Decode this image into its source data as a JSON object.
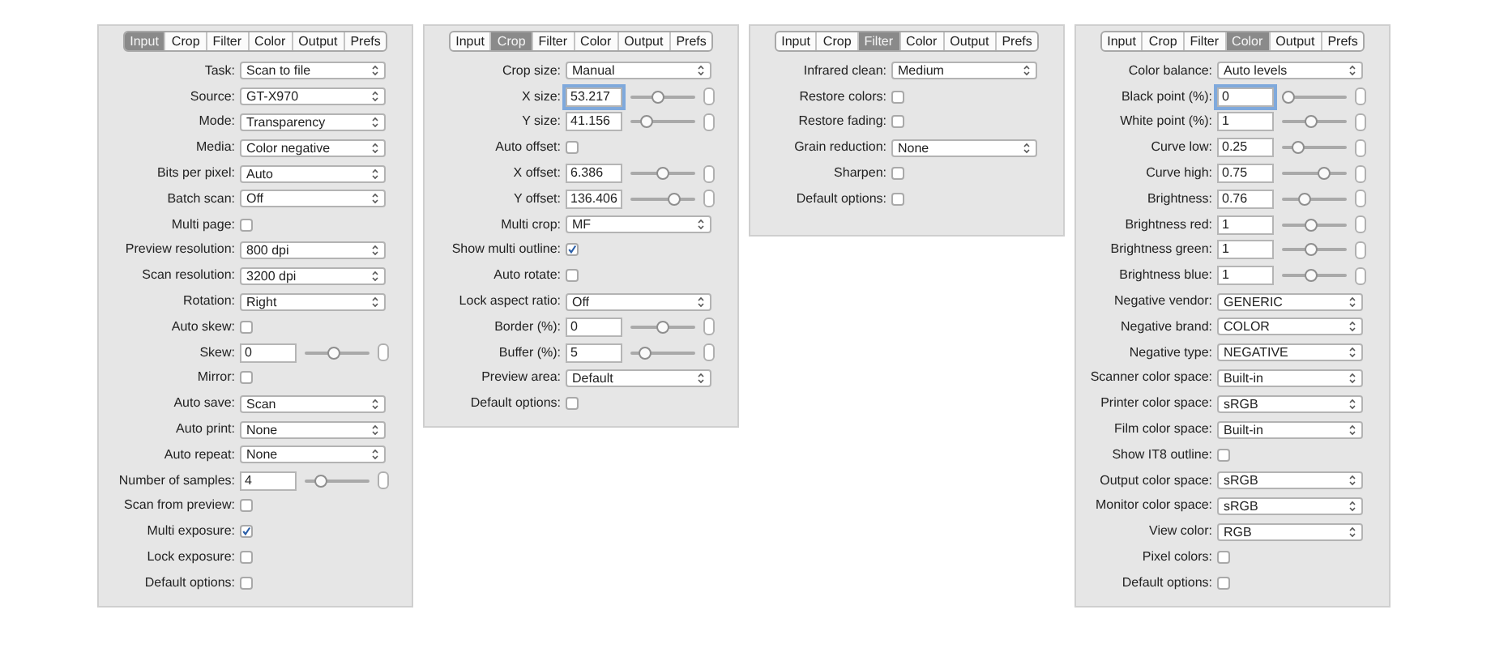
{
  "panels": [
    {
      "tabs": [
        {
          "label": "Input",
          "selected": true
        },
        {
          "label": "Crop",
          "selected": false
        },
        {
          "label": "Filter",
          "selected": false
        },
        {
          "label": "Color",
          "selected": false
        },
        {
          "label": "Output",
          "selected": false
        },
        {
          "label": "Prefs",
          "selected": false
        }
      ],
      "rows": [
        {
          "kind": "select",
          "label": "Task:",
          "value": "Scan to file"
        },
        {
          "kind": "select",
          "label": "Source:",
          "value": "GT-X970"
        },
        {
          "kind": "select",
          "label": "Mode:",
          "value": "Transparency"
        },
        {
          "kind": "select",
          "label": "Media:",
          "value": "Color negative"
        },
        {
          "kind": "select",
          "label": "Bits per pixel:",
          "value": "Auto"
        },
        {
          "kind": "select",
          "label": "Batch scan:",
          "value": "Off"
        },
        {
          "kind": "checkbox",
          "label": "Multi page:",
          "checked": false
        },
        {
          "kind": "select",
          "label": "Preview resolution:",
          "value": "800 dpi"
        },
        {
          "kind": "select",
          "label": "Scan resolution:",
          "value": "3200 dpi"
        },
        {
          "kind": "select",
          "label": "Rotation:",
          "value": "Right"
        },
        {
          "kind": "checkbox",
          "label": "Auto skew:",
          "checked": false
        },
        {
          "kind": "number",
          "label": "Skew:",
          "value": "0",
          "level": 0.45,
          "focused": false
        },
        {
          "kind": "checkbox",
          "label": "Mirror:",
          "checked": false
        },
        {
          "kind": "select",
          "label": "Auto save:",
          "value": "Scan"
        },
        {
          "kind": "select",
          "label": "Auto print:",
          "value": "None"
        },
        {
          "kind": "select",
          "label": "Auto repeat:",
          "value": "None"
        },
        {
          "kind": "number",
          "label": "Number of samples:",
          "value": "4",
          "level": 0.2,
          "focused": false
        },
        {
          "kind": "checkbox",
          "label": "Scan from preview:",
          "checked": false
        },
        {
          "kind": "checkbox",
          "label": "Multi exposure:",
          "checked": true
        },
        {
          "kind": "checkbox",
          "label": "Lock exposure:",
          "checked": false
        },
        {
          "kind": "checkbox",
          "label": "Default options:",
          "checked": false
        }
      ]
    },
    {
      "tabs": [
        {
          "label": "Input",
          "selected": false
        },
        {
          "label": "Crop",
          "selected": true
        },
        {
          "label": "Filter",
          "selected": false
        },
        {
          "label": "Color",
          "selected": false
        },
        {
          "label": "Output",
          "selected": false
        },
        {
          "label": "Prefs",
          "selected": false
        }
      ],
      "rows": [
        {
          "kind": "select",
          "label": "Crop size:",
          "value": "Manual"
        },
        {
          "kind": "number",
          "label": "X size:",
          "value": "53.217",
          "level": 0.4,
          "focused": true
        },
        {
          "kind": "number",
          "label": "Y size:",
          "value": "41.156",
          "level": 0.18,
          "focused": false
        },
        {
          "kind": "checkbox",
          "label": "Auto offset:",
          "checked": false
        },
        {
          "kind": "number",
          "label": "X offset:",
          "value": "6.386",
          "level": 0.5,
          "focused": false
        },
        {
          "kind": "number",
          "label": "Y offset:",
          "value": "136.406",
          "level": 0.72,
          "focused": false
        },
        {
          "kind": "select",
          "label": "Multi crop:",
          "value": "MF"
        },
        {
          "kind": "checkbox",
          "label": "Show multi outline:",
          "checked": true
        },
        {
          "kind": "checkbox",
          "label": "Auto rotate:",
          "checked": false
        },
        {
          "kind": "select",
          "label": "Lock aspect ratio:",
          "value": "Off"
        },
        {
          "kind": "number",
          "label": "Border (%):",
          "value": "0",
          "level": 0.5,
          "focused": false
        },
        {
          "kind": "number",
          "label": "Buffer (%):",
          "value": "5",
          "level": 0.15,
          "focused": false
        },
        {
          "kind": "select",
          "label": "Preview area:",
          "value": "Default"
        },
        {
          "kind": "checkbox",
          "label": "Default options:",
          "checked": false
        }
      ]
    },
    {
      "tabs": [
        {
          "label": "Input",
          "selected": false
        },
        {
          "label": "Crop",
          "selected": false
        },
        {
          "label": "Filter",
          "selected": true
        },
        {
          "label": "Color",
          "selected": false
        },
        {
          "label": "Output",
          "selected": false
        },
        {
          "label": "Prefs",
          "selected": false
        }
      ],
      "rows": [
        {
          "kind": "select",
          "label": "Infrared clean:",
          "value": "Medium"
        },
        {
          "kind": "checkbox",
          "label": "Restore colors:",
          "checked": false
        },
        {
          "kind": "checkbox",
          "label": "Restore fading:",
          "checked": false
        },
        {
          "kind": "select",
          "label": "Grain reduction:",
          "value": "None"
        },
        {
          "kind": "checkbox",
          "label": "Sharpen:",
          "checked": false
        },
        {
          "kind": "checkbox",
          "label": "Default options:",
          "checked": false
        }
      ]
    },
    {
      "tabs": [
        {
          "label": "Input",
          "selected": false
        },
        {
          "label": "Crop",
          "selected": false
        },
        {
          "label": "Filter",
          "selected": false
        },
        {
          "label": "Color",
          "selected": true
        },
        {
          "label": "Output",
          "selected": false
        },
        {
          "label": "Prefs",
          "selected": false
        }
      ],
      "rows": [
        {
          "kind": "select",
          "label": "Color balance:",
          "value": "Auto levels"
        },
        {
          "kind": "number",
          "label": "Black point (%):",
          "value": "0",
          "level": 0.0,
          "focused": true
        },
        {
          "kind": "number",
          "label": "White point (%):",
          "value": "1",
          "level": 0.45,
          "focused": false
        },
        {
          "kind": "number",
          "label": "Curve low:",
          "value": "0.25",
          "level": 0.2,
          "focused": false
        },
        {
          "kind": "number",
          "label": "Curve high:",
          "value": "0.75",
          "level": 0.7,
          "focused": false
        },
        {
          "kind": "number",
          "label": "Brightness:",
          "value": "0.76",
          "level": 0.3,
          "focused": false
        },
        {
          "kind": "number",
          "label": "Brightness red:",
          "value": "1",
          "level": 0.45,
          "focused": false
        },
        {
          "kind": "number",
          "label": "Brightness green:",
          "value": "1",
          "level": 0.45,
          "focused": false
        },
        {
          "kind": "number",
          "label": "Brightness blue:",
          "value": "1",
          "level": 0.45,
          "focused": false
        },
        {
          "kind": "select",
          "label": "Negative vendor:",
          "value": "GENERIC"
        },
        {
          "kind": "select",
          "label": "Negative brand:",
          "value": "COLOR"
        },
        {
          "kind": "select",
          "label": "Negative type:",
          "value": "NEGATIVE"
        },
        {
          "kind": "select",
          "label": "Scanner color space:",
          "value": "Built-in"
        },
        {
          "kind": "select",
          "label": "Printer color space:",
          "value": "sRGB"
        },
        {
          "kind": "select",
          "label": "Film color space:",
          "value": "Built-in"
        },
        {
          "kind": "checkbox",
          "label": "Show IT8 outline:",
          "checked": false
        },
        {
          "kind": "select",
          "label": "Output color space:",
          "value": "sRGB"
        },
        {
          "kind": "select",
          "label": "Monitor color space:",
          "value": "sRGB"
        },
        {
          "kind": "select",
          "label": "View color:",
          "value": "RGB"
        },
        {
          "kind": "checkbox",
          "label": "Pixel colors:",
          "checked": false
        },
        {
          "kind": "checkbox",
          "label": "Default options:",
          "checked": false
        }
      ]
    }
  ]
}
